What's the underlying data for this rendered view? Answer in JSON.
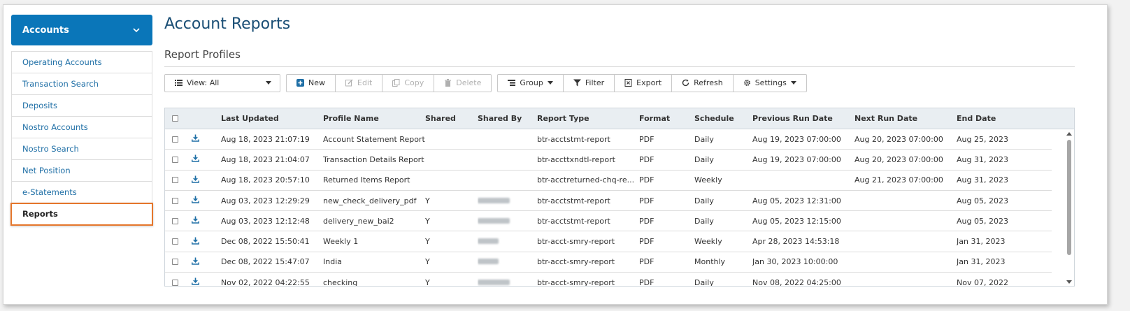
{
  "sidebar": {
    "header": "Accounts",
    "items": [
      {
        "label": "Operating Accounts"
      },
      {
        "label": "Transaction Search"
      },
      {
        "label": "Deposits"
      },
      {
        "label": "Nostro Accounts"
      },
      {
        "label": "Nostro Search"
      },
      {
        "label": "Net Position"
      },
      {
        "label": "e-Statements"
      },
      {
        "label": "Reports"
      }
    ],
    "active_index": 7
  },
  "main": {
    "title": "Account Reports",
    "section_title": "Report Profiles"
  },
  "toolbar": {
    "view": "View: All",
    "new": "New",
    "edit": "Edit",
    "copy": "Copy",
    "delete": "Delete",
    "group": "Group",
    "filter": "Filter",
    "export": "Export",
    "refresh": "Refresh",
    "settings": "Settings"
  },
  "table": {
    "columns": [
      "Last Updated",
      "Profile Name",
      "Shared",
      "Shared By",
      "Report Type",
      "Format",
      "Schedule",
      "Previous Run Date",
      "Next Run Date",
      "End Date"
    ],
    "rows": [
      {
        "updated": "Aug 18, 2023 21:07:19",
        "name": "Account Statement Report",
        "shared": "",
        "type": "btr-acctstmt-report",
        "format": "PDF",
        "schedule": "Daily",
        "prev": "Aug 19, 2023 07:00:00",
        "next": "Aug 20, 2023 07:00:00",
        "end": "Aug 25, 2023"
      },
      {
        "updated": "Aug 18, 2023 21:04:07",
        "name": "Transaction Details Report",
        "shared": "",
        "type": "btr-accttxndtl-report",
        "format": "PDF",
        "schedule": "Daily",
        "prev": "Aug 19, 2023 07:00:00",
        "next": "Aug 20, 2023 07:00:00",
        "end": "Aug 31, 2023"
      },
      {
        "updated": "Aug 18, 2023 20:57:10",
        "name": "Returned Items Report",
        "shared": "",
        "type": "btr-acctreturned-chq-re...",
        "format": "PDF",
        "schedule": "Weekly",
        "prev": "",
        "next": "Aug 21, 2023 07:00:00",
        "end": "Aug 31, 2023"
      },
      {
        "updated": "Aug 03, 2023 12:29:29",
        "name": "new_check_delivery_pdf",
        "shared": "Y",
        "type": "btr-acctstmt-report",
        "format": "PDF",
        "schedule": "Daily",
        "prev": "Aug 05, 2023 12:31:00",
        "next": "",
        "end": "Aug 05, 2023"
      },
      {
        "updated": "Aug 03, 2023 12:12:48",
        "name": "delivery_new_bai2",
        "shared": "Y",
        "type": "btr-acctstmt-report",
        "format": "PDF",
        "schedule": "Daily",
        "prev": "Aug 05, 2023 12:15:00",
        "next": "",
        "end": "Aug 05, 2023"
      },
      {
        "updated": "Dec 08, 2022 15:50:41",
        "name": "Weekly 1",
        "shared": "Y",
        "type": "btr-acct-smry-report",
        "format": "PDF",
        "schedule": "Weekly",
        "prev": "Apr 28, 2023 14:53:18",
        "next": "",
        "end": "Jan 31, 2023"
      },
      {
        "updated": "Dec 08, 2022 15:47:07",
        "name": "India",
        "shared": "Y",
        "type": "btr-acct-smry-report",
        "format": "PDF",
        "schedule": "Monthly",
        "prev": "Jan 30, 2023 10:00:00",
        "next": "",
        "end": "Jan 31, 2023"
      },
      {
        "updated": "Nov 02, 2022 04:22:55",
        "name": "checking",
        "shared": "Y",
        "type": "btr-acct-smry-report",
        "format": "PDF",
        "schedule": "Daily",
        "prev": "Nov 08, 2022 04:25:00",
        "next": "",
        "end": "Nov 07, 2022"
      }
    ]
  },
  "colors": {
    "accent": "#0a76b9",
    "active_border": "#e5762b",
    "link": "#1f6fa6",
    "title": "#1a4e75"
  },
  "icons": {
    "header": "chevron-down-icon",
    "view": "list-icon",
    "new": "plus-icon",
    "edit": "edit-icon",
    "copy": "copy-icon",
    "delete": "trash-icon",
    "group": "group-icon",
    "filter": "filter-icon",
    "export": "export-icon",
    "refresh": "refresh-icon",
    "settings": "gear-icon",
    "row": "download-icon"
  }
}
